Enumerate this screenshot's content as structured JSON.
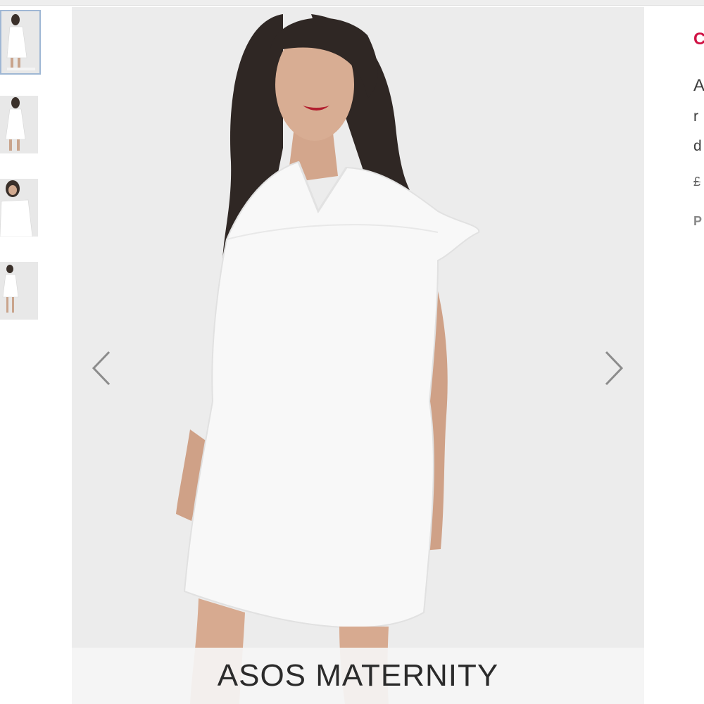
{
  "gallery": {
    "thumbnails": [
      {
        "label": "Product image 1",
        "selected": true
      },
      {
        "label": "Product image 2",
        "selected": false
      },
      {
        "label": "Product image 3",
        "selected": false
      },
      {
        "label": "Product image 4",
        "selected": false
      }
    ],
    "prev_icon": "chevron-left-icon",
    "next_icon": "chevron-right-icon",
    "brand_banner": "ASOS MATERNITY"
  },
  "product_info": {
    "title_fragment": "C",
    "description_lines": [
      "A",
      "r",
      "d"
    ],
    "price_fragment": "£",
    "meta_fragment": "P"
  },
  "colors": {
    "accent": "#d01345",
    "thumb_selected_border": "#9fb7d4",
    "image_background": "#ececec"
  }
}
